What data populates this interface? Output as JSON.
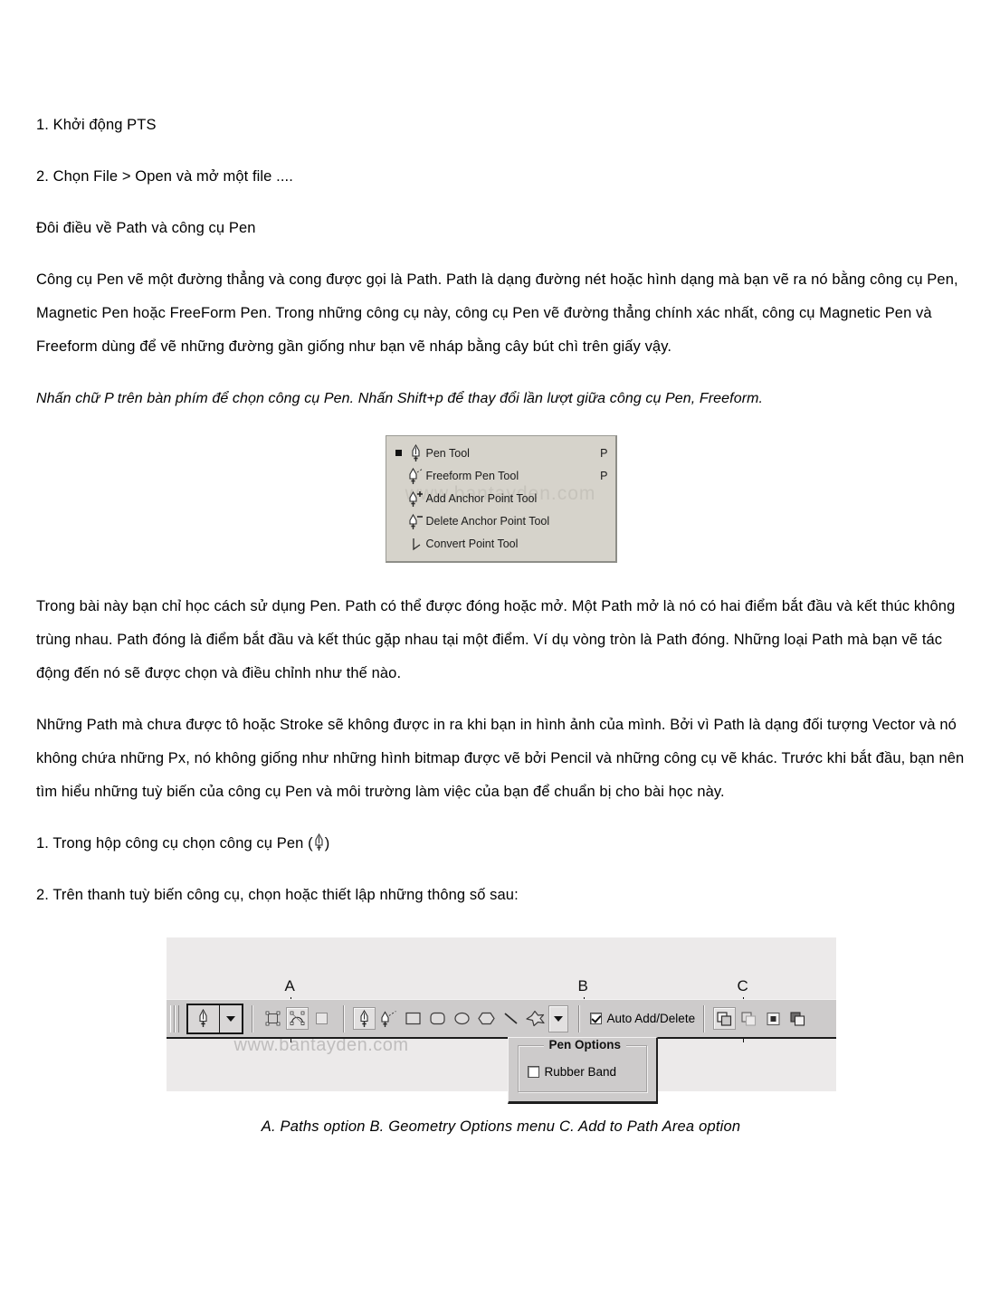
{
  "document": {
    "paragraphs": [
      {
        "id": "p1",
        "style": "plain",
        "text": "1. Khởi động PTS"
      },
      {
        "id": "p2",
        "style": "plain",
        "text": "2. Chọn File > Open và mở một file ...."
      },
      {
        "id": "p3",
        "style": "plain",
        "text": "Đôi điều về Path và công cụ Pen"
      },
      {
        "id": "p4",
        "style": "plain",
        "text": "Công cụ Pen vẽ một đường thẳng và cong được gọi là Path. Path là dạng đường nét hoặc hình dạng mà bạn vẽ ra nó bằng công cụ Pen, Magnetic Pen hoặc FreeForm Pen. Trong những công cụ này, công cụ Pen vẽ đường thẳng chính xác nhất, công cụ Magnetic Pen và Freeform dùng để vẽ những đường gần giống như bạn vẽ nháp bằng cây bút chì trên giấy vậy."
      },
      {
        "id": "p5",
        "style": "italic",
        "text": "Nhấn chữ P trên bàn phím để chọn công cụ Pen. Nhấn Shift+p để thay đổi lần lượt giữa công cụ Pen, Freeform."
      },
      {
        "id": "p6",
        "style": "plain",
        "text": "Trong bài này bạn chỉ học cách sử dụng Pen. Path có thể được đóng hoặc mở. Một Path mở là nó có hai điểm bắt đầu và kết thúc không trùng nhau. Path đóng là điểm bắt đầu và kết thúc gặp nhau tại một điểm. Ví dụ vòng tròn là Path đóng. Những loại Path mà bạn vẽ tác động đến nó sẽ được chọn và điều chỉnh như thế nào."
      },
      {
        "id": "p7",
        "style": "plain",
        "text": "Những Path mà chưa được tô hoặc Stroke sẽ không được in ra khi bạn in hình ảnh của mình. Bởi vì Path là dạng đối tượng Vector và nó không chứa những Px, nó không giống như những hình bitmap được vẽ bởi Pencil và những công cụ vẽ khác. Trước khi bắt đầu, bạn nên tìm hiểu những tuỳ biến của công cụ Pen và môi trường làm việc của bạn để chuẩn bị cho bài học này."
      },
      {
        "id": "p8a",
        "style": "plain",
        "text": "1. Trong hộp công cụ chọn công cụ Pen ("
      },
      {
        "id": "p8b",
        "style": "plain",
        "text": ")"
      },
      {
        "id": "p9",
        "style": "plain",
        "text": "2. Trên thanh tuỳ biến công cụ, chọn hoặc thiết lập những thông số sau:"
      }
    ],
    "caption": "A. Paths option B. Geometry Options menu C. Add to Path Area option"
  },
  "pen_menu": {
    "watermark": "www.bantayden.com",
    "items": [
      {
        "label": "Pen Tool",
        "shortcut": "P",
        "icon": "pen-tool-icon",
        "selected": true
      },
      {
        "label": "Freeform Pen Tool",
        "shortcut": "P",
        "icon": "freeform-pen-tool-icon",
        "selected": false
      },
      {
        "label": "Add Anchor Point Tool",
        "shortcut": "",
        "icon": "add-anchor-point-tool-icon",
        "selected": false
      },
      {
        "label": "Delete Anchor Point Tool",
        "shortcut": "",
        "icon": "delete-anchor-point-tool-icon",
        "selected": false
      },
      {
        "label": "Convert Point Tool",
        "shortcut": "",
        "icon": "convert-point-tool-icon",
        "selected": false
      }
    ]
  },
  "options_bar": {
    "watermark": "www.bantayden.com",
    "callouts": [
      {
        "letter": "A",
        "target": "paths-option"
      },
      {
        "letter": "B",
        "target": "geometry-options-menu"
      },
      {
        "letter": "C",
        "target": "add-to-path-area-option"
      }
    ],
    "active_tool": "pen-tool-icon",
    "mode_buttons": [
      {
        "name": "shape-layers-button",
        "selected": false
      },
      {
        "name": "paths-button",
        "selected": true
      },
      {
        "name": "fill-pixels-button",
        "selected": false
      }
    ],
    "shape_tools": [
      {
        "name": "pen-tool-button",
        "selected": true
      },
      {
        "name": "freeform-pen-tool-button",
        "selected": false
      },
      {
        "name": "rectangle-tool-button",
        "selected": false
      },
      {
        "name": "rounded-rectangle-tool-button",
        "selected": false
      },
      {
        "name": "ellipse-tool-button",
        "selected": false
      },
      {
        "name": "polygon-tool-button",
        "selected": false
      },
      {
        "name": "line-tool-button",
        "selected": false
      },
      {
        "name": "custom-shape-tool-button",
        "selected": false
      }
    ],
    "geometry_dropdown": "chevron-down-icon",
    "auto_add_delete": {
      "label": "Auto Add/Delete",
      "checked": true
    },
    "path_area_buttons": [
      {
        "name": "add-to-path-area-button",
        "selected": true
      },
      {
        "name": "subtract-from-path-area-button",
        "selected": false
      },
      {
        "name": "intersect-path-areas-button",
        "selected": false
      },
      {
        "name": "exclude-overlapping-path-areas-button",
        "selected": false
      }
    ],
    "pen_options_popup": {
      "title": "Pen Options",
      "rubber_band": {
        "label": "Rubber Band",
        "checked": false
      }
    }
  },
  "colors": {
    "page_background": "#ffffff",
    "text": "#000000",
    "menu_background": "#d6d3cb",
    "toolbar_background": "#cdcbcb",
    "figure_background": "#eceaea",
    "watermark": "#c6c3bb"
  }
}
